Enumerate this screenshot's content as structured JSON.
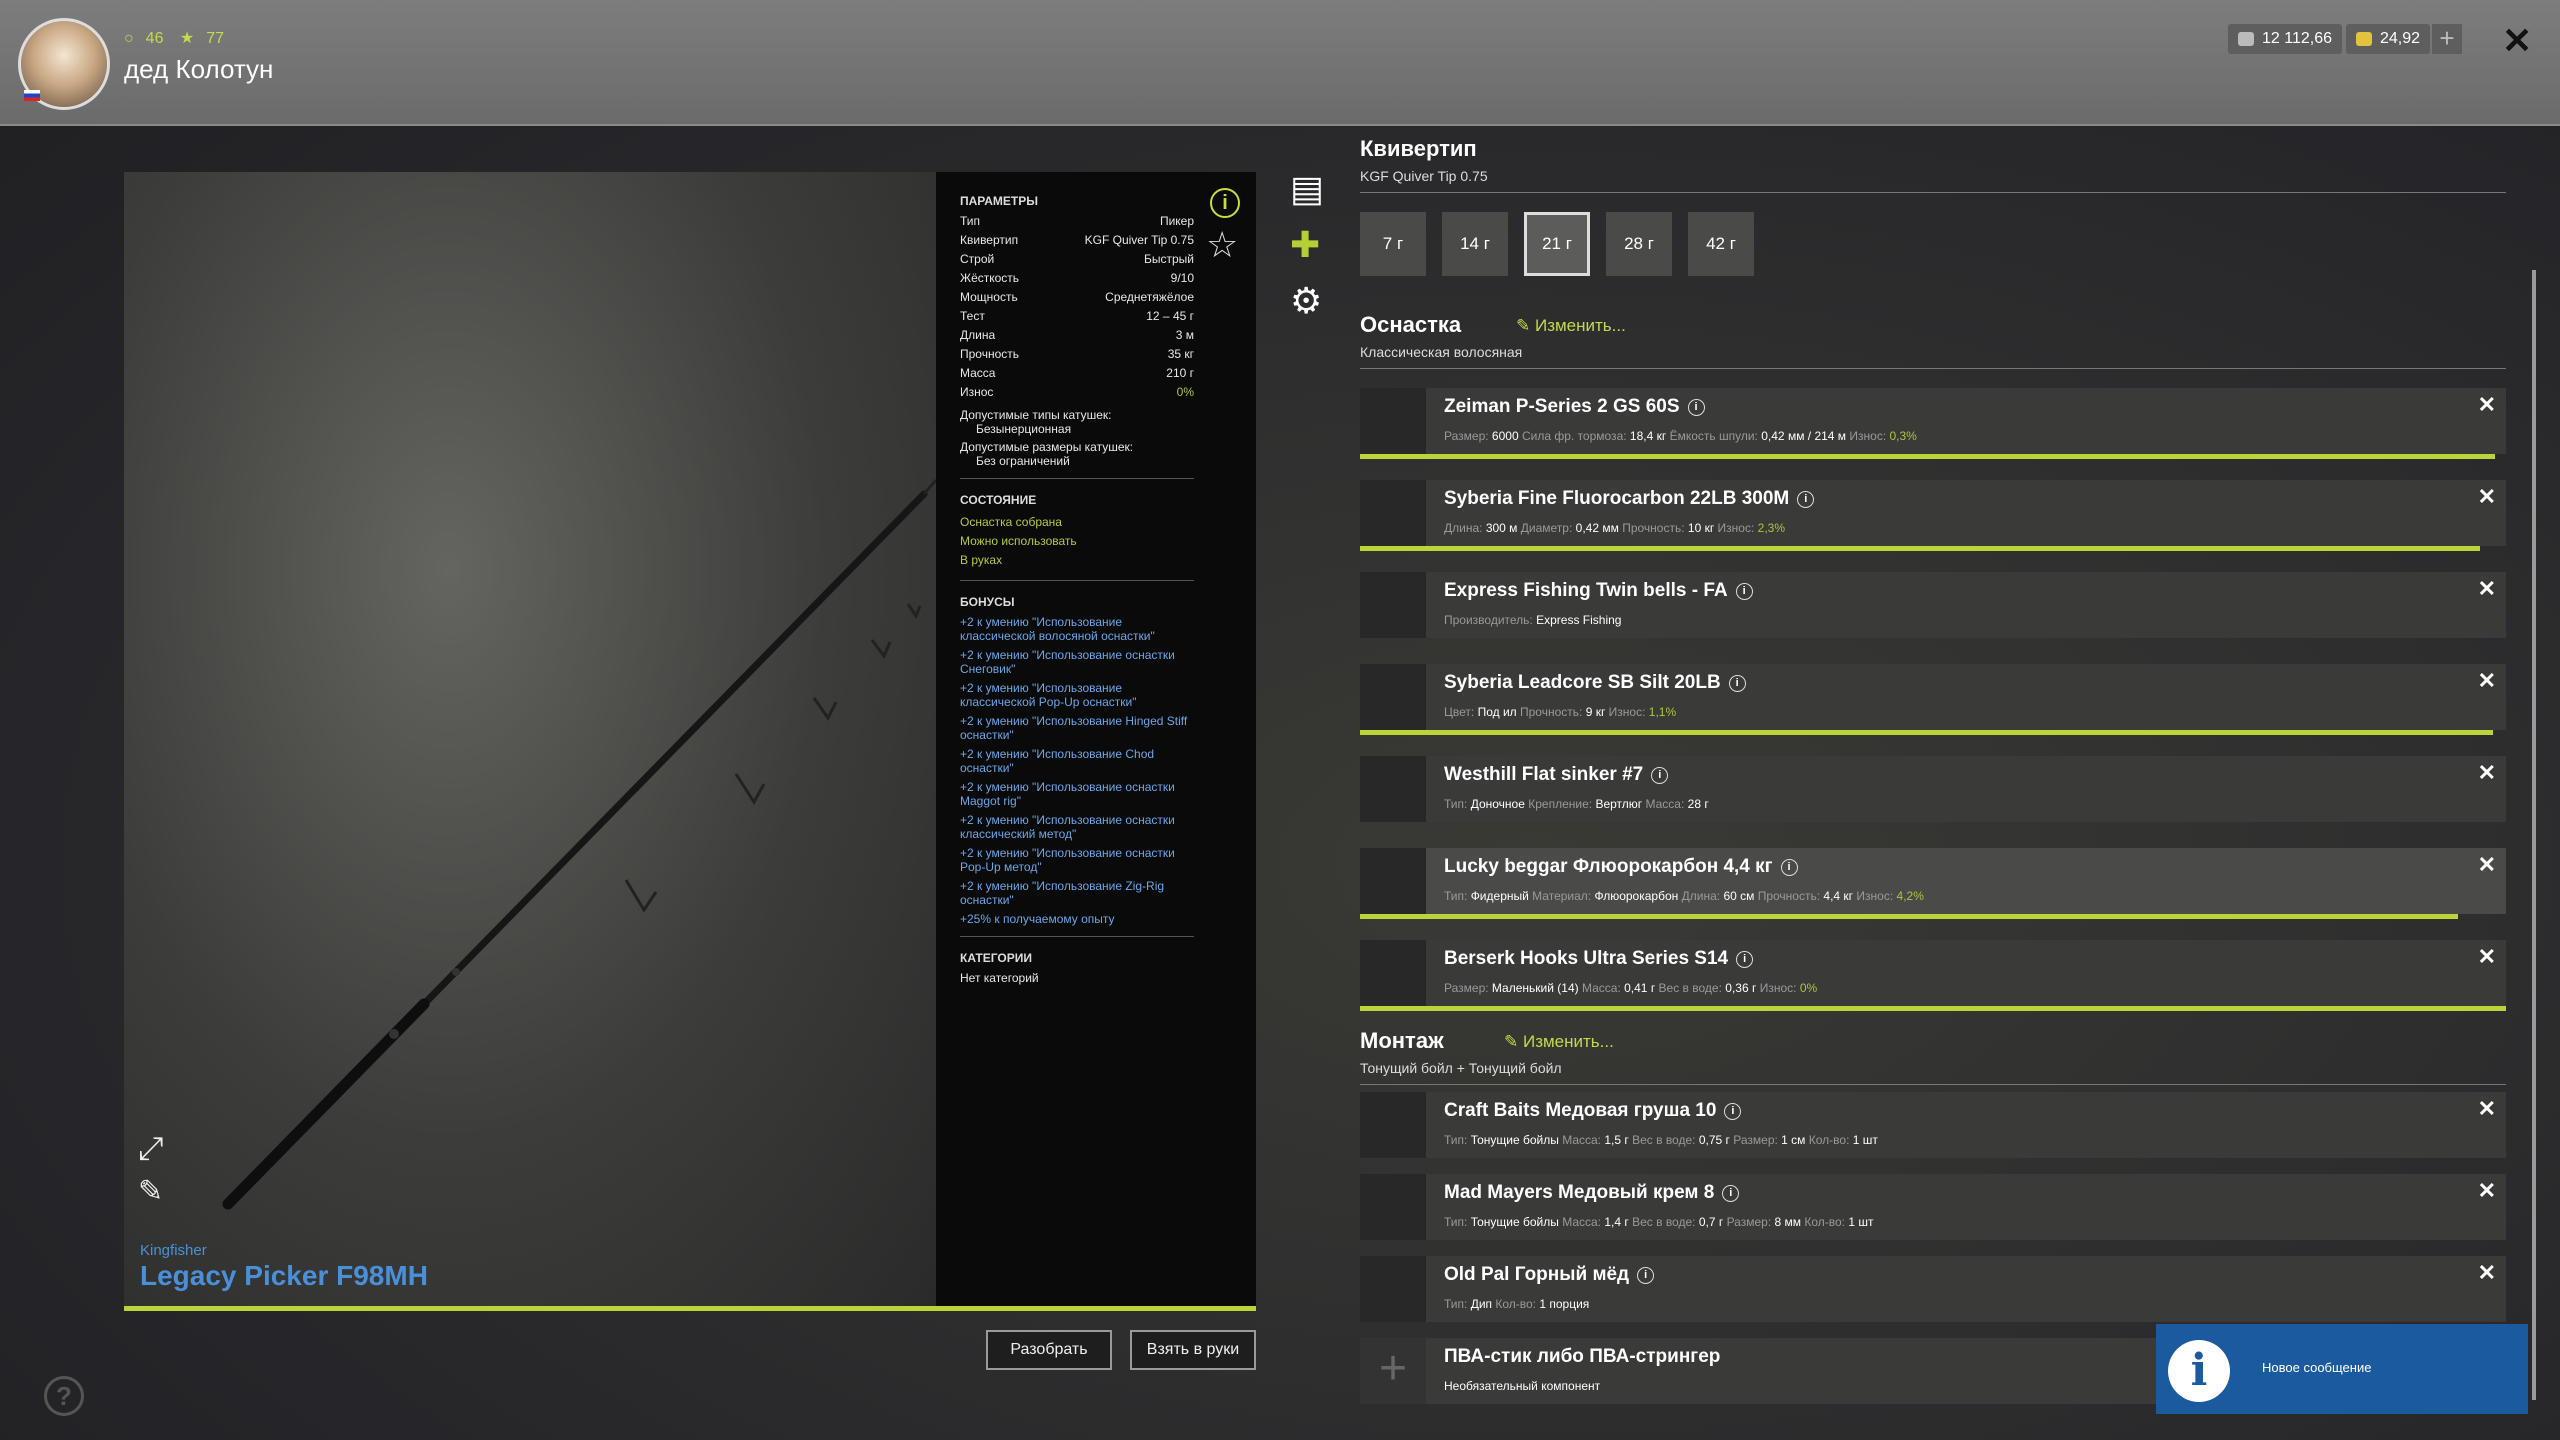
{
  "header": {
    "stats_green": "46",
    "stats_gold": "77",
    "username": "дед Колотун",
    "silver": "12 112,66",
    "gold": "24,92"
  },
  "rod": {
    "brand": "Kingfisher",
    "name": "Legacy Picker F98MH"
  },
  "params": {
    "title": "ПАРАМЕТРЫ",
    "rows": [
      {
        "k": "Тип",
        "v": "Пикер"
      },
      {
        "k": "Квивертип",
        "v": "KGF Quiver Tip 0.75"
      },
      {
        "k": "Строй",
        "v": "Быстрый"
      },
      {
        "k": "Жёсткость",
        "v": "9/10"
      },
      {
        "k": "Мощность",
        "v": "Среднетяжёлое"
      },
      {
        "k": "Тест",
        "v": "12 – 45 г"
      },
      {
        "k": "Длина",
        "v": "3 м"
      },
      {
        "k": "Прочность",
        "v": "35 кг"
      },
      {
        "k": "Масса",
        "v": "210 г"
      },
      {
        "k": "Износ",
        "v": "0%"
      }
    ],
    "reel_types_label": "Допустимые типы катушек:",
    "reel_types_value": "Безынерционная",
    "reel_sizes_label": "Допустимые размеры катушек:",
    "reel_sizes_value": "Без ограничений",
    "state_title": "СОСТОЯНИЕ",
    "state": [
      "Оснастка собрана",
      "Можно использовать",
      "В руках"
    ],
    "bonus_title": "БОНУСЫ",
    "bonuses": [
      "+2 к умению \"Использование классической волосяной оснастки\"",
      "+2 к умению \"Использование оснастки Снеговик\"",
      "+2 к умению \"Использование классической Pop-Up оснастки\"",
      "+2 к умению \"Использование Hinged Stiff оснастки\"",
      "+2 к умению \"Использование Chod оснастки\"",
      "+2 к умению \"Использование оснастки Maggot rig\"",
      "+2 к умению \"Использование оснастки классический метод\"",
      "+2 к умению \"Использование оснастки Pop-Up метод\"",
      "+2 к умению \"Использование Zig-Rig оснастки\"",
      "+25% к получаемому опыту"
    ],
    "cat_title": "КАТЕГОРИИ",
    "cat_value": "Нет категорий"
  },
  "buttons": {
    "disassemble": "Разобрать",
    "take": "Взять в руки"
  },
  "quiver": {
    "title": "Квивертип",
    "subtitle": "KGF Quiver Tip 0.75",
    "options": [
      "7 г",
      "14 г",
      "21 г",
      "28 г",
      "42 г"
    ],
    "selected": "21 г"
  },
  "tackle": {
    "title": "Оснастка",
    "edit": "Изменить...",
    "subtitle": "Классическая волосяная",
    "items": [
      {
        "name": "Zeiman P-Series 2 GS 60S",
        "props": [
          [
            "Размер:",
            "6000"
          ],
          [
            "Сила фр. тормоза:",
            "18,4 кг"
          ],
          [
            "Ёмкость шпули:",
            "0,42 мм / 214 м"
          ],
          [
            "Износ:",
            "0,3%"
          ]
        ],
        "bar": 0.99
      },
      {
        "name": "Syberia Fine Fluorocarbon 22LB 300M",
        "props": [
          [
            "Длина:",
            "300 м"
          ],
          [
            "Диаметр:",
            "0,42 мм"
          ],
          [
            "Прочность:",
            "10 кг"
          ],
          [
            "Износ:",
            "2,3%"
          ]
        ],
        "bar": 0.977
      },
      {
        "name": "Express Fishing Twin bells - FA",
        "props": [
          [
            "Производитель:",
            "Express Fishing"
          ]
        ],
        "bar": null
      },
      {
        "name": "Syberia Leadcore SB Silt 20LB",
        "props": [
          [
            "Цвет:",
            "Под ил"
          ],
          [
            "Прочность:",
            "9 кг"
          ],
          [
            "Износ:",
            "1,1%"
          ]
        ],
        "bar": 0.989
      },
      {
        "name": "Westhill Flat sinker #7",
        "props": [
          [
            "Тип:",
            "Доночное"
          ],
          [
            "Крепление:",
            "Вертлюг"
          ],
          [
            "Масса:",
            "28 г"
          ]
        ],
        "bar": null
      },
      {
        "name": "Lucky beggar Флюорокарбон 4,4 кг",
        "props": [
          [
            "Тип:",
            "Фидерный"
          ],
          [
            "Материал:",
            "Флюорокарбон"
          ],
          [
            "Длина:",
            "60 см"
          ],
          [
            "Прочность:",
            "4,4 кг"
          ],
          [
            "Износ:",
            "4,2%"
          ]
        ],
        "bar": 0.958
      },
      {
        "name": "Berserk Hooks Ultra Series S14",
        "props": [
          [
            "Размер:",
            "Маленький (14)"
          ],
          [
            "Масса:",
            "0,41 г"
          ],
          [
            "Вес в воде:",
            "0,36 г"
          ],
          [
            "Износ:",
            "0%"
          ]
        ],
        "bar": 1.0
      }
    ]
  },
  "montage": {
    "title": "Монтаж",
    "edit": "Изменить...",
    "subtitle": "Тонущий бойл + Тонущий бойл",
    "items": [
      {
        "name": "Craft Baits Медовая груша 10",
        "props": [
          [
            "Тип:",
            "Тонущие бойлы"
          ],
          [
            "Масса:",
            "1,5 г"
          ],
          [
            "Вес в воде:",
            "0,75 г"
          ],
          [
            "Размер:",
            "1 см"
          ],
          [
            "Кол-во:",
            "1 шт"
          ]
        ]
      },
      {
        "name": "Mad Mayers Медовый крем 8",
        "props": [
          [
            "Тип:",
            "Тонущие бойлы"
          ],
          [
            "Масса:",
            "1,4 г"
          ],
          [
            "Вес в воде:",
            "0,7 г"
          ],
          [
            "Размер:",
            "8 мм"
          ],
          [
            "Кол-во:",
            "1 шт"
          ]
        ]
      },
      {
        "name": "Old Pal Горный мёд",
        "props": [
          [
            "Тип:",
            "Дип"
          ],
          [
            "Кол-во:",
            "1 порция"
          ]
        ]
      },
      {
        "name": "ПВА-стик либо ПВА-стрингер",
        "props": [
          [
            "",
            "Необязательный компонент"
          ]
        ]
      }
    ]
  },
  "toast": {
    "text": "Новое сообщение"
  },
  "colors": {
    "accent": "#bcd43a",
    "blue": "#4a90d9",
    "toast": "#1c5aa0"
  }
}
